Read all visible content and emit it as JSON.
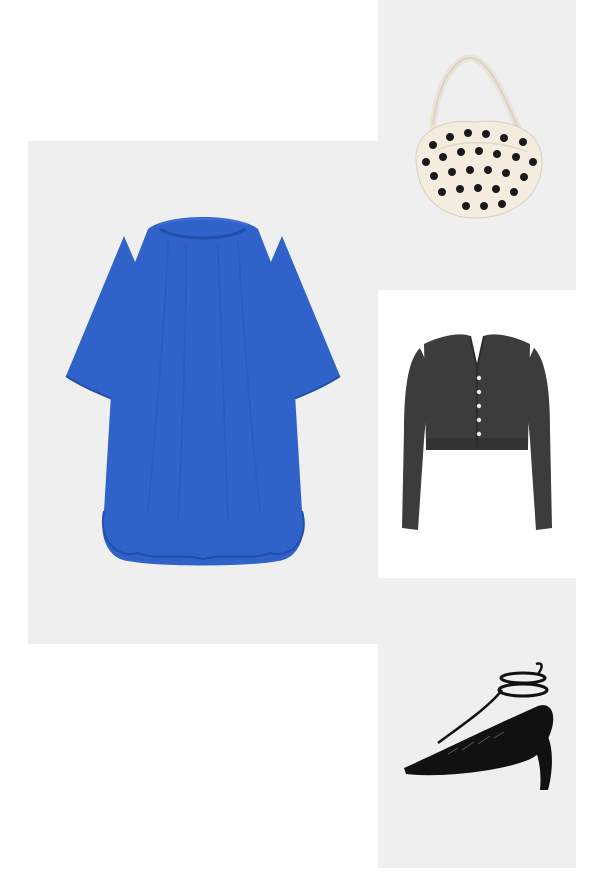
{
  "collage": {
    "items": [
      {
        "product": "polka-dot-shoulder-bag",
        "colors": {
          "body": "#f3ecdf",
          "dots": "#1a1a1a"
        }
      },
      {
        "product": "blue-bubble-hem-dress",
        "colors": {
          "main": "#2f63c9",
          "shade": "#224fa8"
        }
      },
      {
        "product": "charcoal-cropped-cardigan",
        "colors": {
          "main": "#3b3c3b",
          "buttons": "#e8e8e8"
        }
      },
      {
        "product": "black-lace-up-pointed-heel",
        "colors": {
          "main": "#111111"
        }
      }
    ],
    "tile_background": "#efefef",
    "page_background": "#ffffff"
  }
}
